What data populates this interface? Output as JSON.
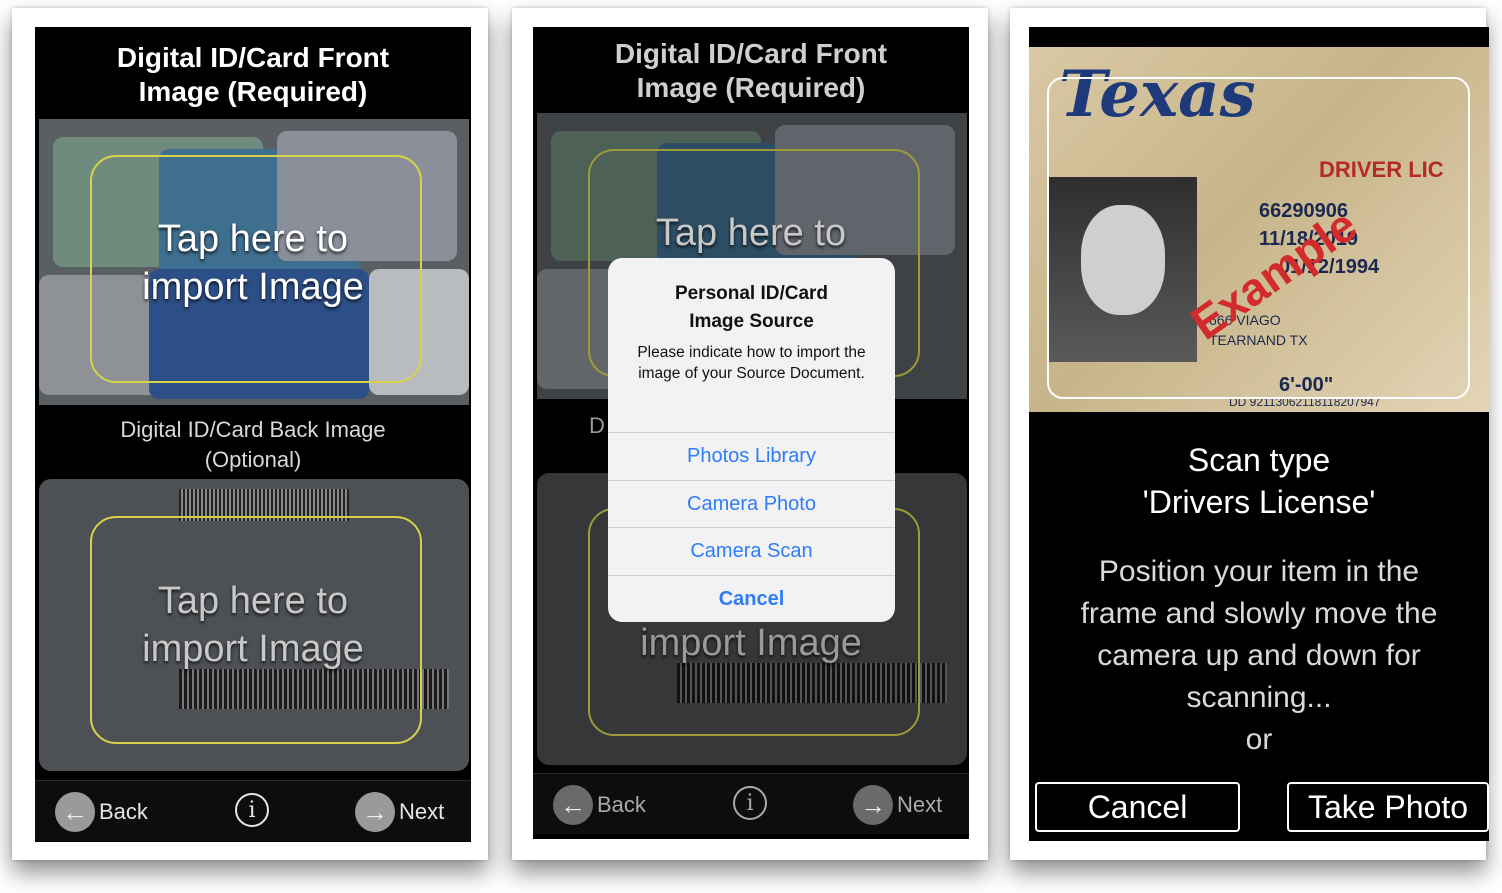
{
  "screen1": {
    "title_line1": "Digital ID/Card Front",
    "title_line2": "Image (Required)",
    "front_tap_line1": "Tap here to",
    "front_tap_line2": "import Image",
    "back_label_line1": "Digital ID/Card Back Image",
    "back_label_line2": "(Optional)",
    "back_tap_line1": "Tap here to",
    "back_tap_line2": "import Image",
    "back_label": "Back",
    "next_label": "Next"
  },
  "screen2": {
    "title_line1": "Digital ID/Card Front",
    "title_line2": "Image (Required)",
    "front_tap_line1": "Tap here to",
    "back_label_partial": "D",
    "back_tap_line2": "import Image",
    "back_label": "Back",
    "next_label": "Next",
    "dialog": {
      "title_line1": "Personal ID/Card",
      "title_line2": "Image Source",
      "message": "Please indicate how to import the image of your Source Document.",
      "options": [
        "Photos Library",
        "Camera Photo",
        "Camera Scan"
      ],
      "cancel": "Cancel"
    }
  },
  "screen3": {
    "card_state": "Texas",
    "card_type": "DRIVER LIC",
    "dl_number": "66290906",
    "iss_date": "11/18/2019",
    "dob": "01/12/1994",
    "address": "666 VIAGO",
    "city": "TEARNAND TX",
    "height": "6'-00\"",
    "dd_number": "DD 92113062118118207947",
    "watermark": "Example",
    "scan_title_line1": "Scan type",
    "scan_title_line2": "'Drivers License'",
    "instructions": [
      "Position your item in the",
      "frame and slowly move the",
      "camera up and down for",
      "scanning...",
      "or"
    ],
    "cancel_label": "Cancel",
    "take_photo_label": "Take Photo"
  },
  "colors": {
    "frame_yellow": "#d8d24a",
    "ios_blue": "#2f7cf6",
    "nav_circle": "#9a9a9a"
  },
  "icons": {
    "back": "arrow-left-icon",
    "next": "arrow-right-icon",
    "info": "info-icon"
  }
}
